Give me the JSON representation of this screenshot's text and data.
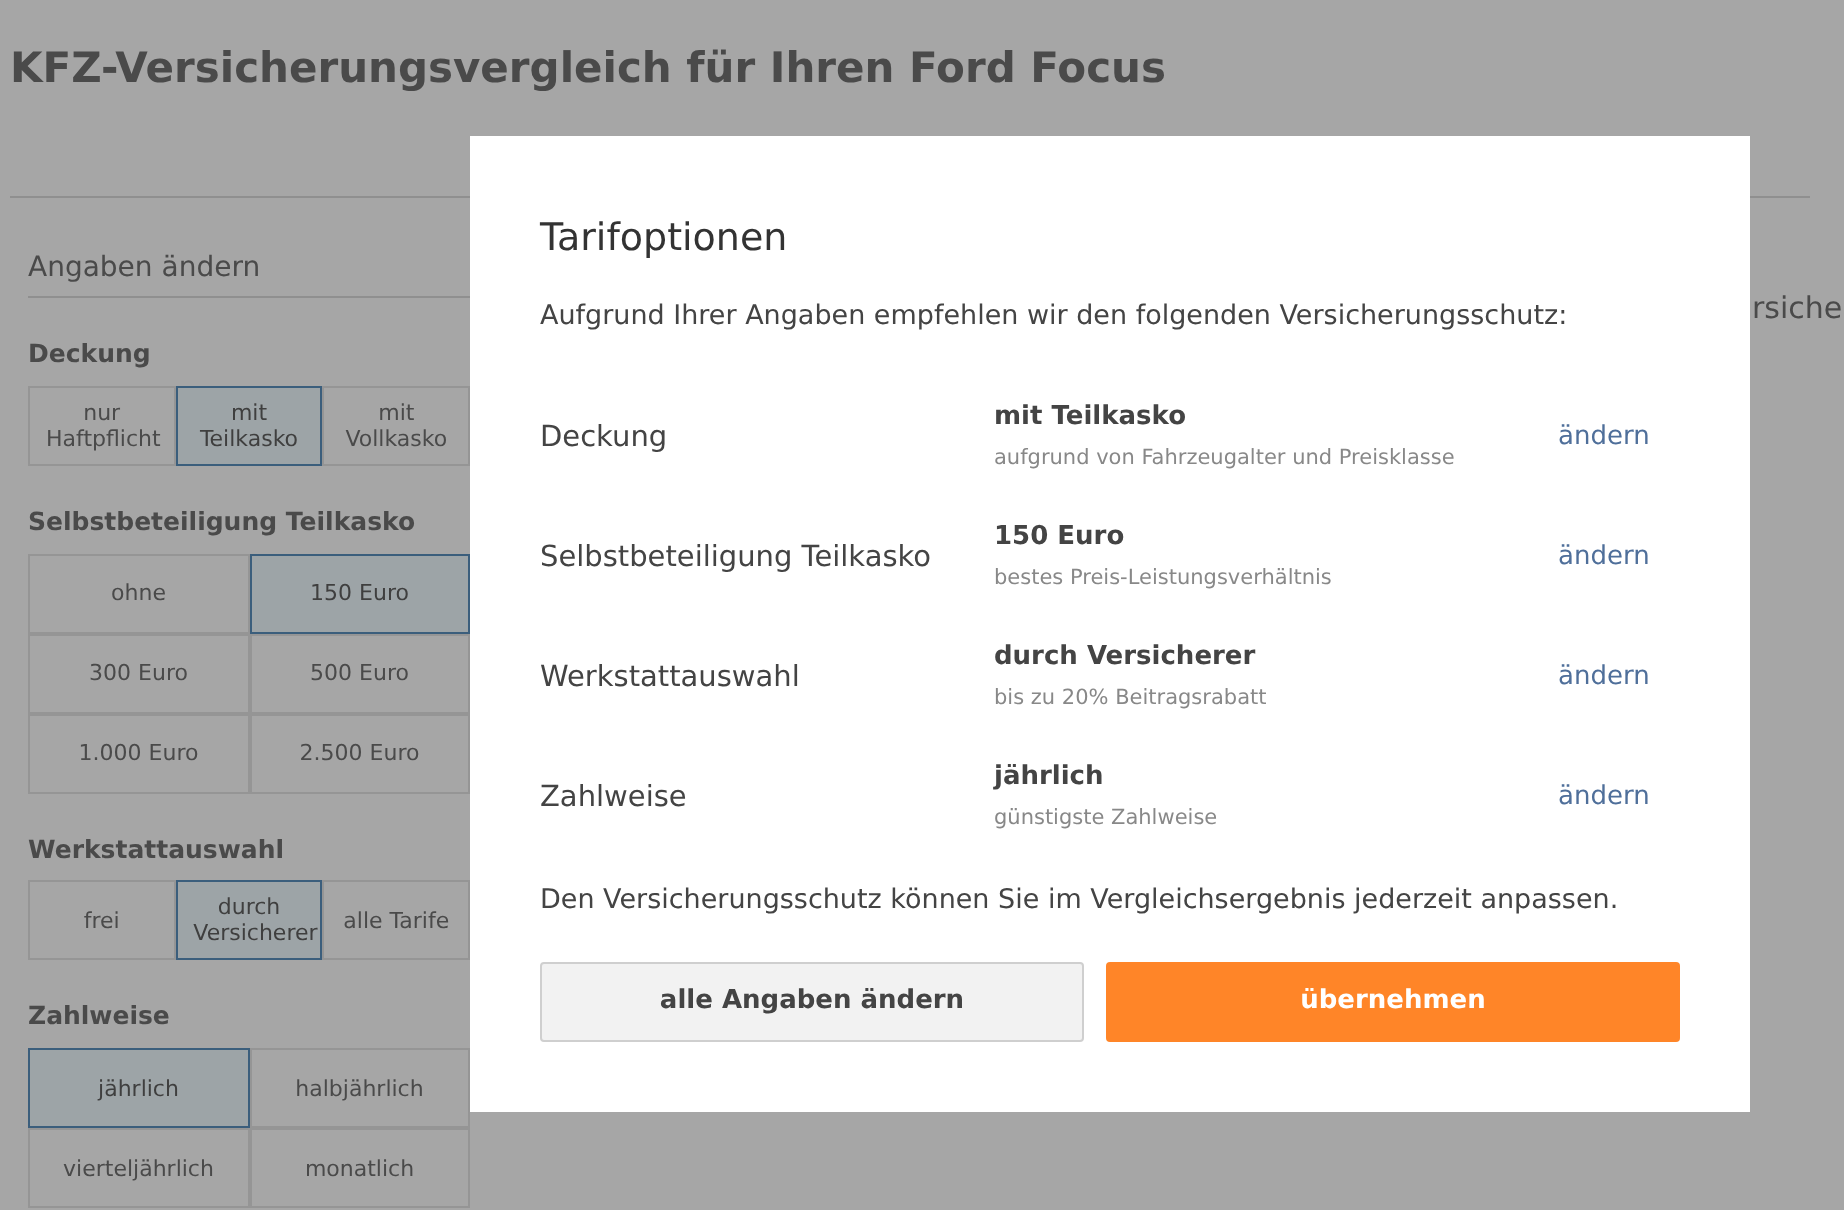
{
  "page": {
    "title": "KFZ-Versicherungsvergleich für Ihren Ford Focus",
    "right_fragment": "rsiche"
  },
  "sidebar": {
    "heading": "Angaben ändern",
    "groups": [
      {
        "label": "Deckung",
        "options": [
          {
            "label": "nur Haftpflicht",
            "selected": false
          },
          {
            "label": "mit Teilkasko",
            "selected": true
          },
          {
            "label": "mit Vollkasko",
            "selected": false
          }
        ]
      },
      {
        "label": "Selbstbeteiligung Teilkasko",
        "options": [
          {
            "label": "ohne",
            "selected": false
          },
          {
            "label": "150 Euro",
            "selected": true
          },
          {
            "label": "300 Euro",
            "selected": false
          },
          {
            "label": "500 Euro",
            "selected": false
          },
          {
            "label": "1.000 Euro",
            "selected": false
          },
          {
            "label": "2.500 Euro",
            "selected": false
          }
        ]
      },
      {
        "label": "Werkstattauswahl",
        "options": [
          {
            "label": "frei",
            "selected": false
          },
          {
            "label": "durch Versicherer",
            "selected": true
          },
          {
            "label": "alle Tarife",
            "selected": false
          }
        ]
      },
      {
        "label": "Zahlweise",
        "options": [
          {
            "label": "jährlich",
            "selected": true
          },
          {
            "label": "halbjährlich",
            "selected": false
          },
          {
            "label": "vierteljährlich",
            "selected": false
          },
          {
            "label": "monatlich",
            "selected": false
          }
        ]
      }
    ]
  },
  "modal": {
    "title": "Tarifoptionen",
    "intro": "Aufgrund Ihrer Angaben empfehlen wir den folgenden Versicherungsschutz:",
    "rows": [
      {
        "label": "Deckung",
        "value": "mit Teilkasko",
        "note": "aufgrund von Fahrzeugalter und Preisklasse",
        "link": "ändern"
      },
      {
        "label": "Selbstbeteiligung Teilkasko",
        "value": "150 Euro",
        "note": "bestes Preis-Leistungsverhältnis",
        "link": "ändern"
      },
      {
        "label": "Werkstattauswahl",
        "value": "durch Versicherer",
        "note": "bis zu 20% Beitragsrabatt",
        "link": "ändern"
      },
      {
        "label": "Zahlweise",
        "value": "jährlich",
        "note": "günstigste Zahlweise",
        "link": "ändern"
      }
    ],
    "footer": "Den Versicherungsschutz können Sie im Vergleichsergebnis jederzeit anpassen.",
    "buttons": [
      {
        "label": "alle Angaben ändern",
        "kind": "secondary"
      },
      {
        "label": "übernehmen",
        "kind": "primary"
      }
    ]
  }
}
